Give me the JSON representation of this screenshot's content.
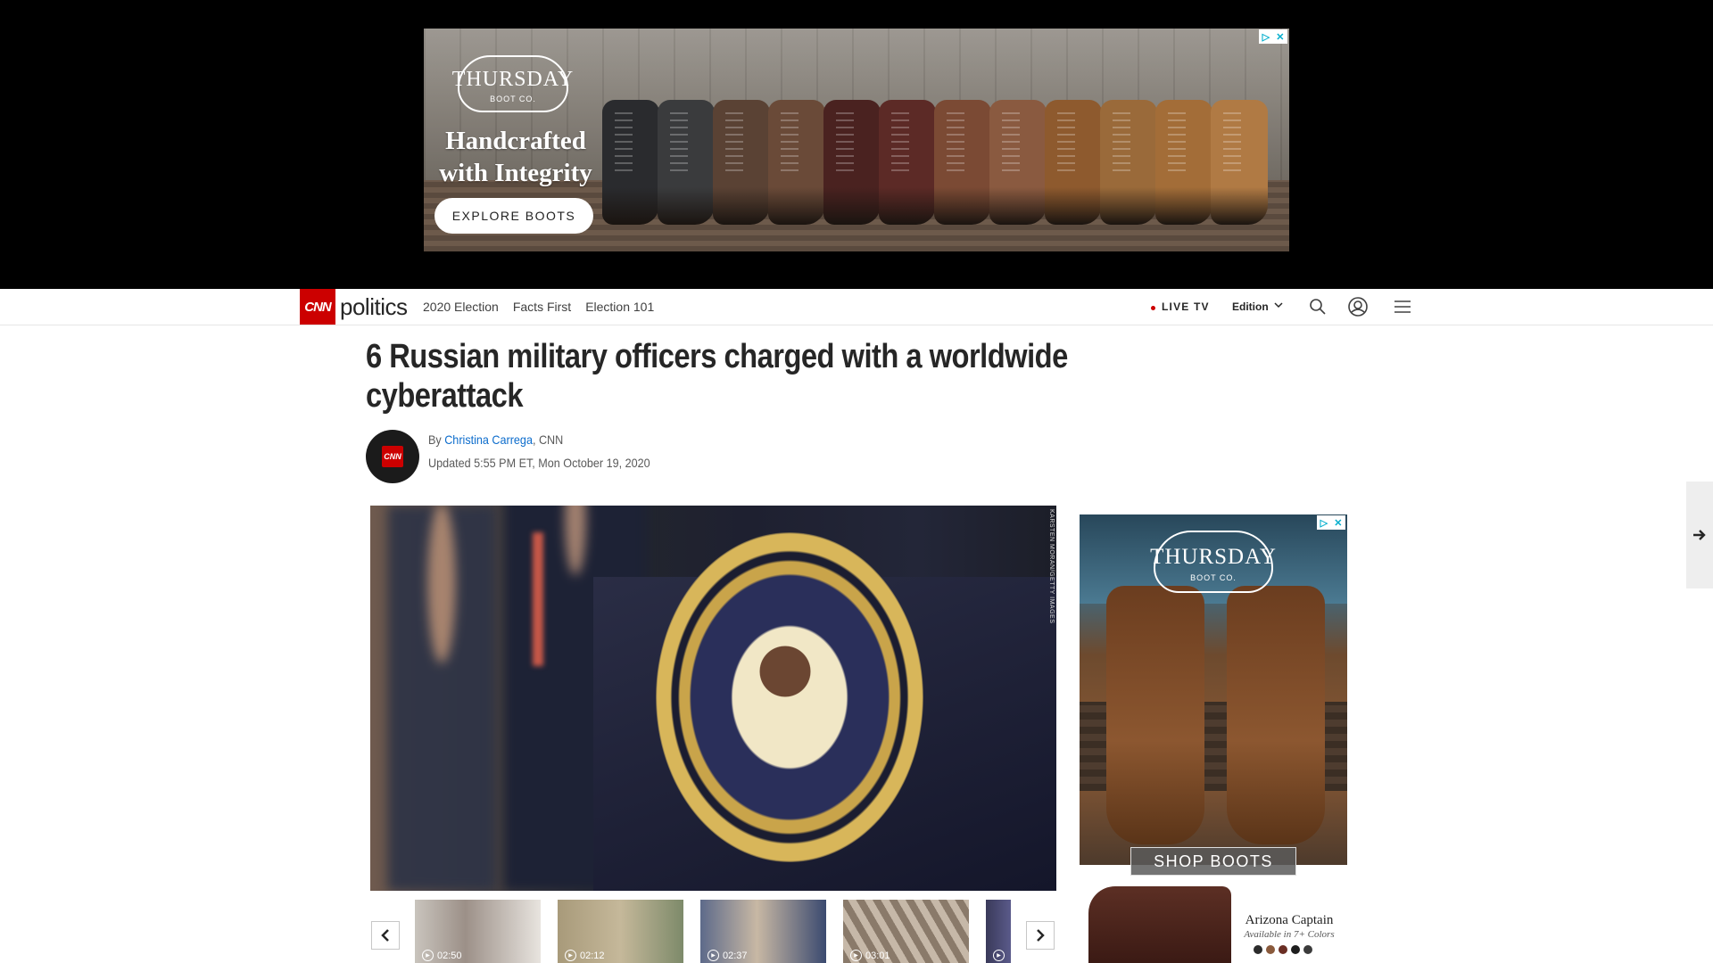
{
  "top_ad": {
    "brand": "THURSDAY",
    "brand_sub": "BOOT CO.",
    "headline_line1": "Handcrafted",
    "headline_line2": "with Integrity",
    "cta": "EXPLORE BOOTS",
    "adchoices_icons": [
      "play-triangle-icon",
      "close-x-icon"
    ],
    "boot_colors": [
      "#2a2b2e",
      "#3a3b3d",
      "#5a4234",
      "#6a4a38",
      "#4a2220",
      "#5c2a26",
      "#7b4a34",
      "#8a5a40",
      "#8e5a2e",
      "#9a6a3a",
      "#a36d38",
      "#b07a44"
    ]
  },
  "nav": {
    "logo": "CNN",
    "section": "politics",
    "links": [
      "2020 Election",
      "Facts First",
      "Election 101"
    ],
    "live_tv": "LIVE TV",
    "edition": "Edition",
    "icons": [
      "search-icon",
      "account-icon",
      "menu-icon"
    ]
  },
  "article": {
    "headline": "6 Russian military officers charged with a worldwide cyberattack",
    "byline_prefix": "By",
    "author": "Christina Carrega",
    "outlet": ", CNN",
    "updated": "Updated 5:55 PM ET, Mon October 19, 2020",
    "avatar_logo": "CNN",
    "hero_credit": "KARSTEN MORAN/GETTY IMAGES"
  },
  "carousel": {
    "thumbs": [
      {
        "duration": "02:50",
        "bg": "linear-gradient(90deg,#c9c4bd,#9c9088 40%,#e8e4df)"
      },
      {
        "duration": "02:12",
        "bg": "linear-gradient(90deg,#a89a7a,#c5b89a 50%,#7d8a6a)"
      },
      {
        "duration": "02:37",
        "bg": "linear-gradient(90deg,#5d6a8a,#c8b8a4 45%,#3b4a70)"
      },
      {
        "duration": "03:01",
        "bg": "repeating-linear-gradient(60deg,#8a7a6a 0 8px,#c6b8a8 8px 16px)"
      },
      {
        "duration": "",
        "bg": "linear-gradient(90deg,#3a3a5a,#5a5a8a)"
      }
    ],
    "prev_icon": "chevron-left-icon",
    "next_icon": "chevron-right-icon"
  },
  "rail_ad": {
    "brand": "THURSDAY",
    "brand_sub": "BOOT CO.",
    "cta": "SHOP BOOTS",
    "product_name": "Arizona Captain",
    "product_colors": "Available in 7+ Colors",
    "swatches": [
      "#2b2b2b",
      "#8a5a3c",
      "#6a2e24",
      "#1e1e1e",
      "#3b3b3b"
    ]
  },
  "next_article_icon": "arrow-right-icon"
}
